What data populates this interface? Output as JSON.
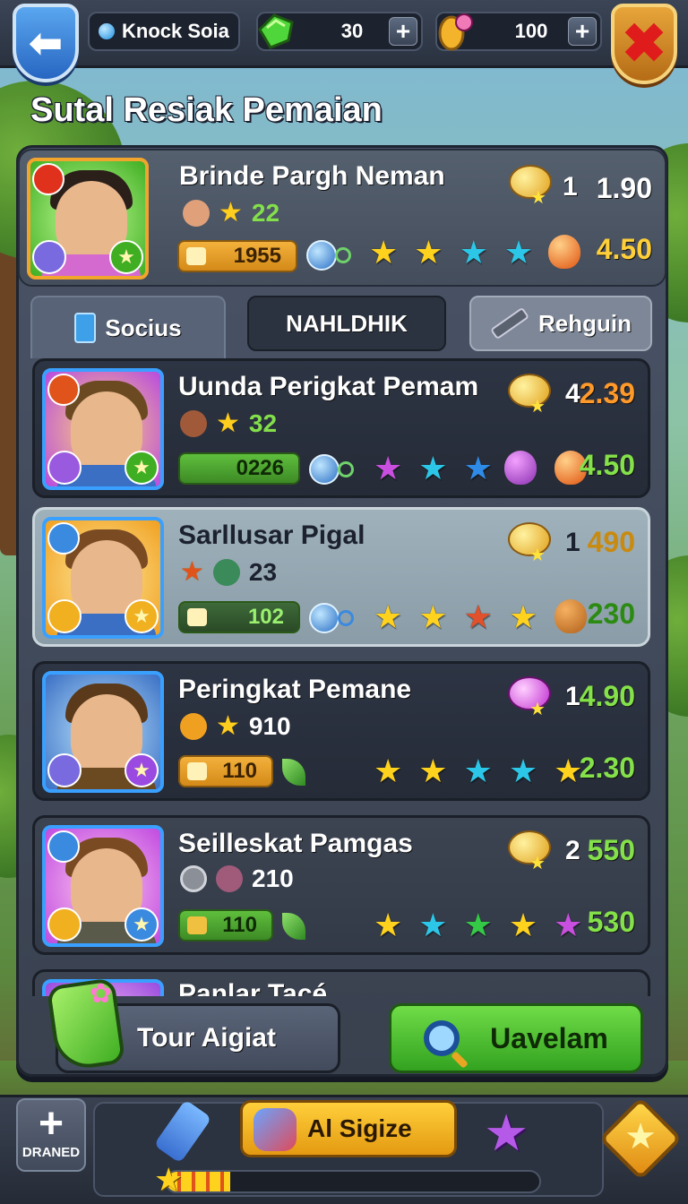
{
  "topbar": {
    "player_name": "Knock Soia",
    "gems": "30",
    "coins": "100",
    "back_icon": "back-arrow-icon",
    "close_icon": "close-x-icon"
  },
  "page_title": "Sutal Resiak Pemaian",
  "my_player": {
    "name": "Brinde Pargh Neman",
    "level": "22",
    "bar_value": "1955",
    "count": "1",
    "value_top": "1.90",
    "value_bottom": "4.50",
    "stars": [
      "yellow",
      "yellow",
      "cyan",
      "cyan"
    ]
  },
  "tabs": [
    {
      "label": "Socius"
    },
    {
      "label": "NAHLDHIK"
    },
    {
      "label": "Rehguin"
    }
  ],
  "rows": [
    {
      "name": "Uunda Perigkat Pemam",
      "level": "32",
      "bar_value": "0226",
      "count": "4",
      "value_top": "2.39",
      "value_bottom": "4.50",
      "stars": [
        "purple",
        "cyan",
        "blue"
      ]
    },
    {
      "name": "Sarllusar Pigal",
      "level": "23",
      "bar_value": "102",
      "count": "1",
      "value_top": "490",
      "value_bottom": "230",
      "stars": [
        "yellow",
        "yellow",
        "red",
        "yellow"
      ]
    },
    {
      "name": "Peringkat Pemane",
      "level": "910",
      "bar_value": "110",
      "count": "1",
      "value_top": "4.90",
      "value_bottom": "2.30",
      "stars": [
        "yellow",
        "yellow",
        "cyan",
        "cyan",
        "yellow"
      ]
    },
    {
      "name": "Seilleskat Pamgas",
      "level": "210",
      "bar_value": "110",
      "count": "2",
      "value_top": "550",
      "value_bottom": "530",
      "stars": [
        "yellow",
        "cyan",
        "green",
        "yellow",
        "purple"
      ]
    },
    {
      "name": "Panlar Tacé",
      "level": "",
      "bar_value": "",
      "count": "",
      "value_top": "",
      "value_bottom": "",
      "stars": []
    }
  ],
  "footer": {
    "tour_label": "Tour Aigiat",
    "search_label": "Uavelam"
  },
  "bottombar": {
    "drained_label": "DRANED",
    "ai_label": "Al Sigize",
    "progress": 0.17
  }
}
